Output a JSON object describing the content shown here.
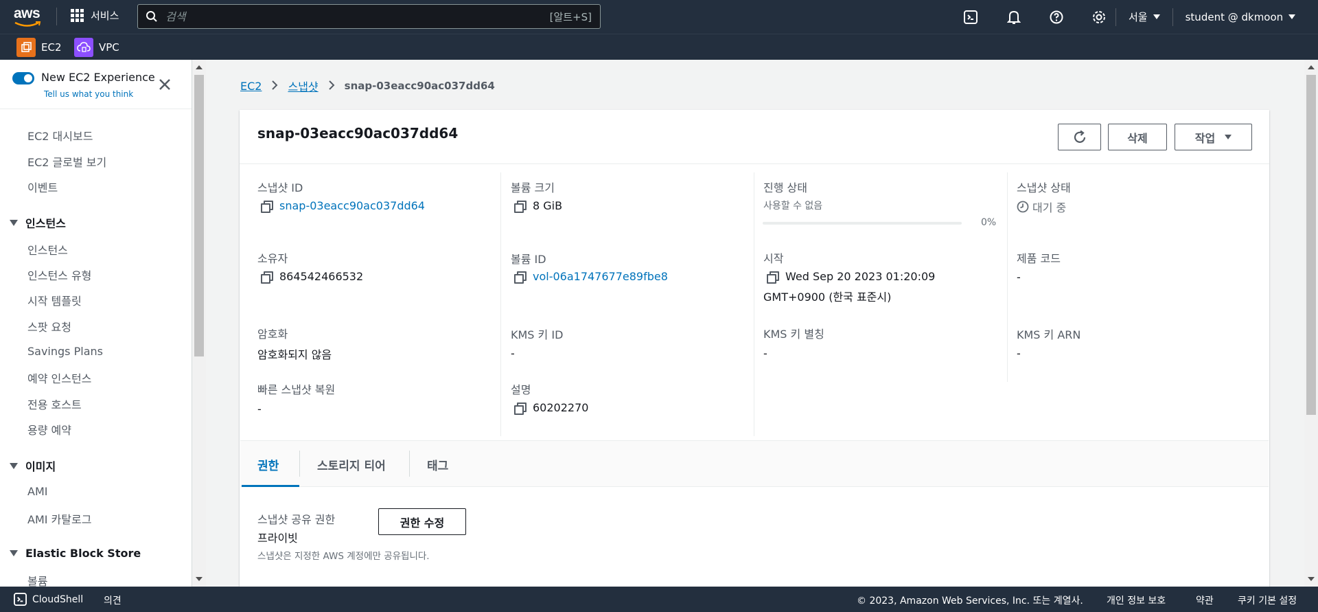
{
  "topnav": {
    "logo_text": "aws",
    "services_label": "서비스",
    "search_placeholder": "검색",
    "search_shortcut": "[알트+S]",
    "region": "서울",
    "user": "student @ dkmoon"
  },
  "favorites": [
    {
      "label": "EC2",
      "color": "#e7711b"
    },
    {
      "label": "VPC",
      "color": "#8c4fff"
    }
  ],
  "sidebar": {
    "new_experience": "New EC2 Experience",
    "feedback_link": "Tell us what you think",
    "top_items": [
      "EC2 대시보드",
      "EC2 글로벌 보기",
      "이벤트"
    ],
    "sections": [
      {
        "title": "인스턴스",
        "items": [
          "인스턴스",
          "인스턴스 유형",
          "시작 템플릿",
          "스팟 요청",
          "Savings Plans",
          "예약 인스턴스",
          "전용 호스트",
          "용량 예약"
        ]
      },
      {
        "title": "이미지",
        "items": [
          "AMI",
          "AMI 카탈로그"
        ]
      },
      {
        "title": "Elastic Block Store",
        "items": [
          "볼륨"
        ]
      }
    ]
  },
  "breadcrumb": {
    "root": "EC2",
    "parent": "스냅샷",
    "current": "snap-03eacc90ac037dd64"
  },
  "panel": {
    "title": "snap-03eacc90ac037dd64",
    "buttons": {
      "delete": "삭제",
      "actions": "작업"
    },
    "fields": {
      "snapshot_id_label": "스냅샷 ID",
      "snapshot_id": "snap-03eacc90ac037dd64",
      "volume_size_label": "볼륨 크기",
      "volume_size": "8 GiB",
      "progress_label": "진행 상태",
      "progress_sub": "사용할 수 없음",
      "progress_value": "0%",
      "progress_fraction": 0,
      "snapshot_state_label": "스냅샷 상태",
      "snapshot_state": "대기 중",
      "owner_label": "소유자",
      "owner": "864542466532",
      "volume_id_label": "볼륨 ID",
      "volume_id": "vol-06a1747677e89fbe8",
      "start_label": "시작",
      "start_line1": "Wed Sep 20 2023 01:20:09",
      "start_line2": "GMT+0900 (한국 표준시)",
      "product_code_label": "제품 코드",
      "product_code": "-",
      "encryption_label": "암호화",
      "encryption": "암호화되지 않음",
      "kms_id_label": "KMS 키 ID",
      "kms_id": "-",
      "kms_alias_label": "KMS 키 별칭",
      "kms_alias": "-",
      "kms_arn_label": "KMS 키 ARN",
      "kms_arn": "-",
      "fast_restore_label": "빠른 스냅샷 복원",
      "fast_restore": "-",
      "description_label": "설명",
      "description": "60202270"
    },
    "tabs": [
      "권한",
      "스토리지 티어",
      "태그"
    ],
    "permissions": {
      "label": "스냅샷 공유 권한",
      "value": "프라이빗",
      "note": "스냅샷은 지정한 AWS 계정에만 공유됩니다.",
      "edit_button": "권한 수정"
    }
  },
  "footer": {
    "cloudshell": "CloudShell",
    "feedback": "의견",
    "copyright": "© 2023, Amazon Web Services, Inc. 또는 계열사.",
    "privacy": "개인 정보 보호",
    "terms": "약관",
    "cookies": "쿠키 기본 설정"
  }
}
